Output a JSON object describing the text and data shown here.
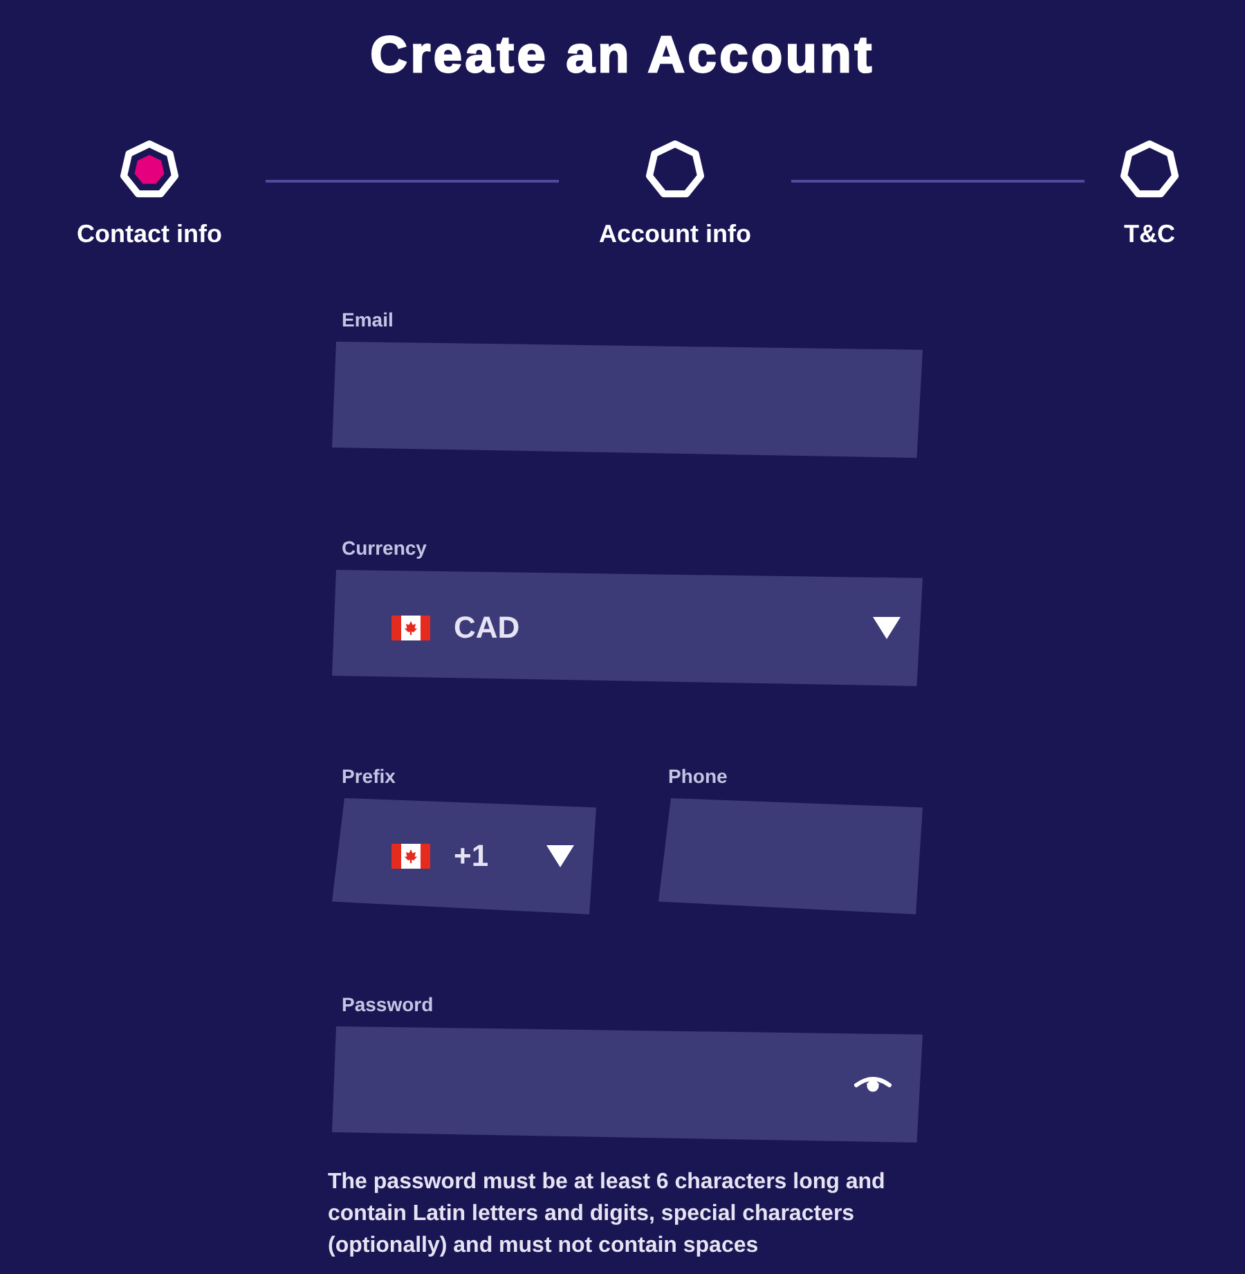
{
  "page": {
    "title": "Create an Account"
  },
  "steps": [
    {
      "label": "Contact info",
      "selected": true
    },
    {
      "label": "Account info",
      "selected": false
    },
    {
      "label": "T&C",
      "selected": false
    }
  ],
  "form": {
    "rows": [
      {
        "fields": [
          {
            "kind": "text",
            "label": "Email"
          }
        ]
      },
      {
        "fields": [
          {
            "kind": "select",
            "label": "Currency",
            "value": "CAD"
          }
        ]
      },
      {
        "fields": [
          {
            "kind": "select",
            "label": "Prefix",
            "value": "+1"
          },
          {
            "kind": "text",
            "label": "Phone"
          }
        ]
      },
      {
        "fields": [
          {
            "kind": "password",
            "label": "Password"
          }
        ]
      }
    ],
    "hint": "The password must be at least 6 characters long and contain Latin letters and digits, special characters (optionally) and must not contain spaces"
  }
}
